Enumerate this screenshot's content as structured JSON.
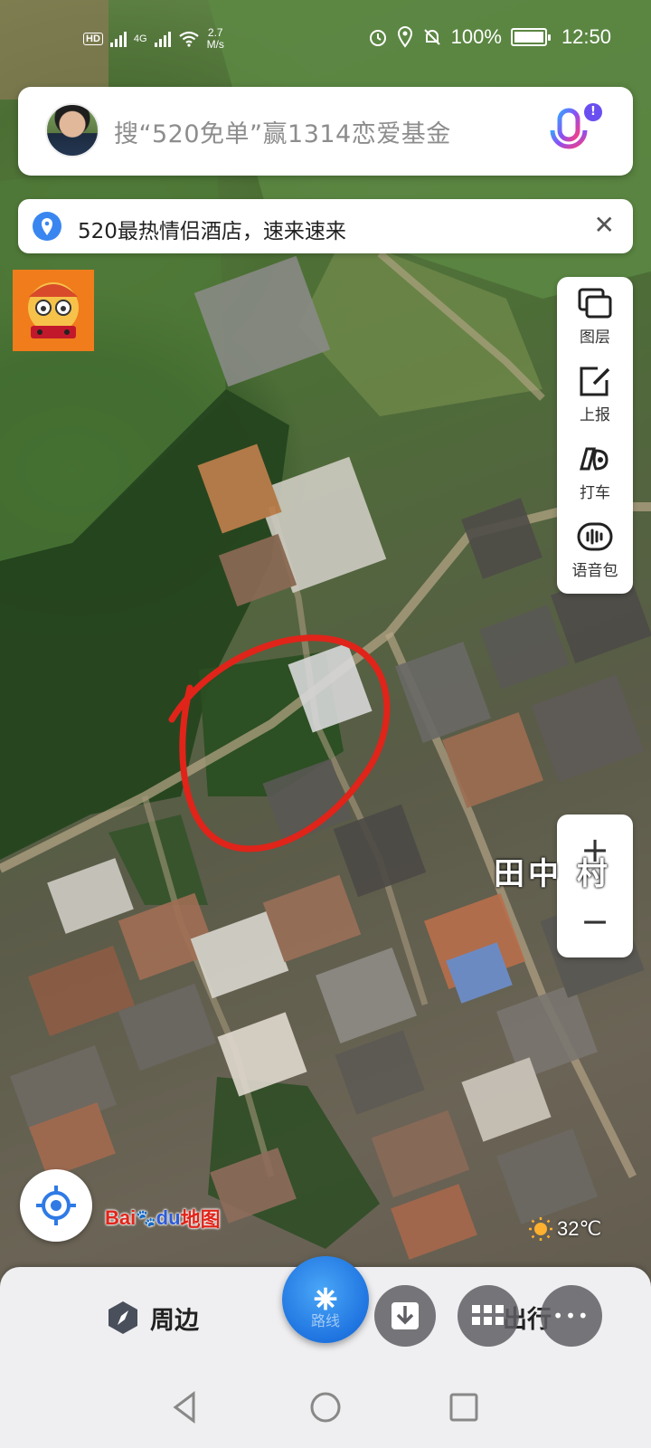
{
  "status_bar": {
    "network_speed_value": "2.7",
    "network_speed_unit": "M/s",
    "battery": "100%",
    "time": "12:50",
    "hd_label": "HD",
    "signal_label": "4G"
  },
  "search": {
    "placeholder": "搜“520免单”赢1314恋爱基金",
    "mic_badge": "!"
  },
  "notice": {
    "text": "520最热情侣酒店，速来速来",
    "close_symbol": "✕"
  },
  "tools": [
    {
      "label": "图层",
      "icon": "layers-icon"
    },
    {
      "label": "上报",
      "icon": "report-edit-icon"
    },
    {
      "label": "打车",
      "icon": "taxi-icon"
    },
    {
      "label": "语音包",
      "icon": "voice-pack-icon"
    }
  ],
  "zoom": {
    "in_symbol": "+",
    "out_symbol": "−"
  },
  "map": {
    "village_label": "田中  村",
    "logo_text_a": "Bai",
    "logo_text_b": "du",
    "logo_text_c": "地图",
    "temperature": "32℃"
  },
  "bottom": {
    "nearby_label": "周边",
    "route_label": "路线",
    "travel_label": "出行",
    "route_glyph": "⁕",
    "more_symbol": "•••"
  },
  "colors": {
    "accent_blue": "#1f74e0",
    "mascot_orange": "#f07c1c",
    "highlight_red": "#e0241a"
  }
}
